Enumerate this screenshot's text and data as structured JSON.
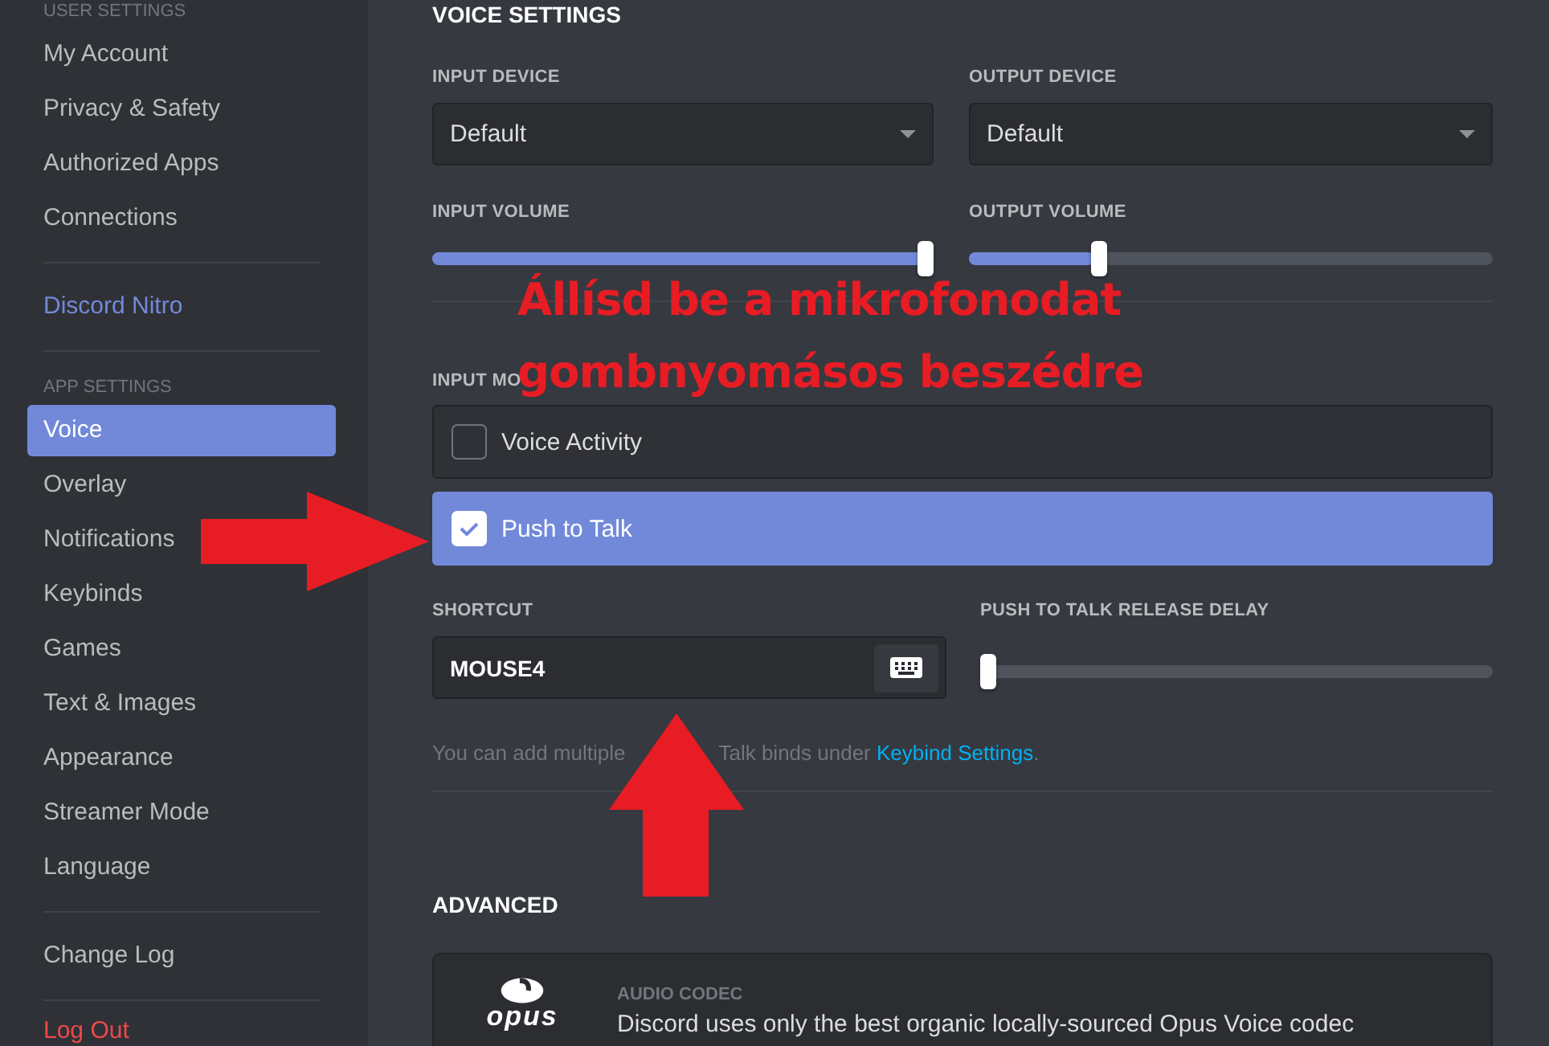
{
  "sidebar": {
    "groups": [
      {
        "header": "USER SETTINGS",
        "items": [
          {
            "label": "My Account",
            "kind": "normal",
            "selected": false
          },
          {
            "label": "Privacy & Safety",
            "kind": "normal",
            "selected": false
          },
          {
            "label": "Authorized Apps",
            "kind": "normal",
            "selected": false
          },
          {
            "label": "Connections",
            "kind": "normal",
            "selected": false
          }
        ]
      },
      {
        "items": [
          {
            "label": "Discord Nitro",
            "kind": "nitro",
            "selected": false
          }
        ]
      },
      {
        "header": "APP SETTINGS",
        "items": [
          {
            "label": "Voice",
            "kind": "normal",
            "selected": true
          },
          {
            "label": "Overlay",
            "kind": "normal",
            "selected": false
          },
          {
            "label": "Notifications",
            "kind": "normal",
            "selected": false
          },
          {
            "label": "Keybinds",
            "kind": "normal",
            "selected": false
          },
          {
            "label": "Games",
            "kind": "normal",
            "selected": false
          },
          {
            "label": "Text & Images",
            "kind": "normal",
            "selected": false
          },
          {
            "label": "Appearance",
            "kind": "normal",
            "selected": false
          },
          {
            "label": "Streamer Mode",
            "kind": "normal",
            "selected": false
          },
          {
            "label": "Language",
            "kind": "normal",
            "selected": false
          }
        ]
      },
      {
        "items": [
          {
            "label": "Change Log",
            "kind": "normal",
            "selected": false
          }
        ]
      },
      {
        "items": [
          {
            "label": "Log Out",
            "kind": "danger",
            "selected": false
          }
        ]
      }
    ]
  },
  "voice_settings": {
    "title": "VOICE SETTINGS",
    "devices": [
      {
        "label": "INPUT DEVICE",
        "value": "Default"
      },
      {
        "label": "OUTPUT DEVICE",
        "value": "Default"
      }
    ],
    "volumes": [
      {
        "label": "INPUT VOLUME",
        "level": 1.0
      },
      {
        "label": "OUTPUT VOLUME",
        "level": 0.24
      }
    ],
    "input_mode": {
      "label": "INPUT MO",
      "options": [
        {
          "label": "Voice Activity",
          "selected": false
        },
        {
          "label": "Push to Talk",
          "selected": true
        }
      ]
    },
    "shortcut": {
      "label": "SHORTCUT",
      "value": "MOUSE4"
    },
    "release_delay": {
      "label": "PUSH TO TALK RELEASE DELAY",
      "level": 0
    },
    "hint": {
      "before": "You can add multiple",
      "after": "Talk binds under",
      "link": "Keybind Settings",
      "end": "."
    }
  },
  "advanced": {
    "title": "ADVANCED",
    "codec": {
      "logo_text": "opus",
      "label": "AUDIO CODEC",
      "description": "Discord uses only the best organic locally-sourced Opus Voice codec"
    }
  },
  "annotation": {
    "lines": [
      "Állísd be a mikrofonodat",
      "gombnyomásos beszédre"
    ]
  }
}
